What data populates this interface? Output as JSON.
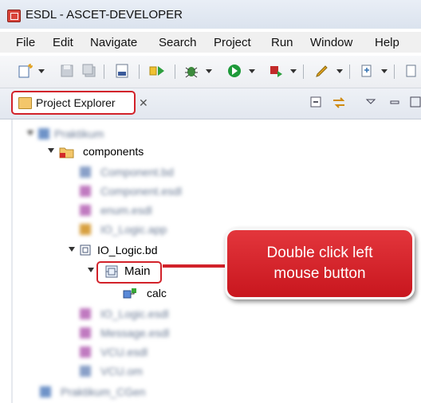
{
  "window": {
    "title": "ESDL - ASCET-DEVELOPER",
    "accent": "#d2222a"
  },
  "menubar": {
    "items": [
      "File",
      "Edit",
      "Navigate",
      "Search",
      "Project",
      "Run",
      "Window",
      "Help"
    ]
  },
  "toolbar": {
    "icons": [
      "new-icon",
      "save-icon",
      "save-all-icon",
      "binary-icon",
      "build-icon",
      "debug-icon",
      "run-icon",
      "external-tools-icon",
      "pen-icon",
      "next-annotation-icon"
    ]
  },
  "tab": {
    "label": "Project Explorer",
    "close_glyph": "✕"
  },
  "tree": {
    "components_label": "components",
    "io_logic_label": "IO_Logic.bd",
    "main_label": "Main",
    "calc_label": "calc",
    "blurred_items": [
      "Praktikum",
      "Component.bd",
      "Component.esdl",
      "enum.esdl",
      "IO_Logic.app",
      "IO_Logic.esdl",
      "Message.esdl",
      "VCU.esdl",
      "VCU.om",
      "Praktikum_CGen"
    ]
  },
  "callout": {
    "line1": "Double click left",
    "line2": "mouse button"
  }
}
